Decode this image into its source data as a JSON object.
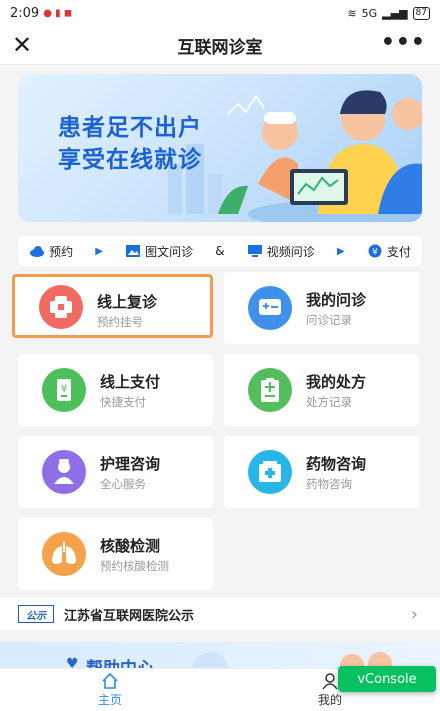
{
  "status": {
    "time": "2:09",
    "signal": "5G",
    "battery": "87"
  },
  "nav": {
    "title": "互联网诊室",
    "close_icon": "close-icon",
    "more_label": "•••"
  },
  "banner": {
    "line1": "患者足不出户",
    "line2": "享受在线就诊"
  },
  "steps": [
    {
      "label": "预约",
      "icon": "cloud-icon"
    },
    {
      "label": "图文问诊",
      "icon": "image-icon"
    },
    {
      "label": "&"
    },
    {
      "label": "视频问诊",
      "icon": "monitor-icon"
    },
    {
      "label": "支付",
      "icon": "yen-icon"
    }
  ],
  "cards": [
    {
      "title": "线上复诊",
      "sub": "预约挂号",
      "color": "#f26b62",
      "highlighted": true
    },
    {
      "title": "我的问诊",
      "sub": "问诊记录",
      "color": "#3f91ec"
    },
    {
      "title": "线上支付",
      "sub": "快捷支付",
      "color": "#4cc05a"
    },
    {
      "title": "我的处方",
      "sub": "处方记录",
      "color": "#56bd5c"
    },
    {
      "title": "护理咨询",
      "sub": "全心服务",
      "color": "#8f6ee8"
    },
    {
      "title": "药物咨询",
      "sub": "药物咨询",
      "color": "#28b5e8"
    },
    {
      "title": "核酸检测",
      "sub": "预约核酸检测",
      "color": "#f5a24b"
    }
  ],
  "notice": {
    "badge": "公示",
    "text": "江苏省互联网医院公示"
  },
  "help": {
    "title": "帮助中心"
  },
  "tabs": [
    {
      "label": "主页",
      "icon": "home-icon",
      "active": true
    },
    {
      "label": "我的",
      "icon": "user-icon"
    }
  ],
  "vconsole": "vConsole",
  "colors": {
    "accent": "#2d8cf0",
    "vconsole": "#07c160",
    "highlight": "#f39b4d"
  }
}
